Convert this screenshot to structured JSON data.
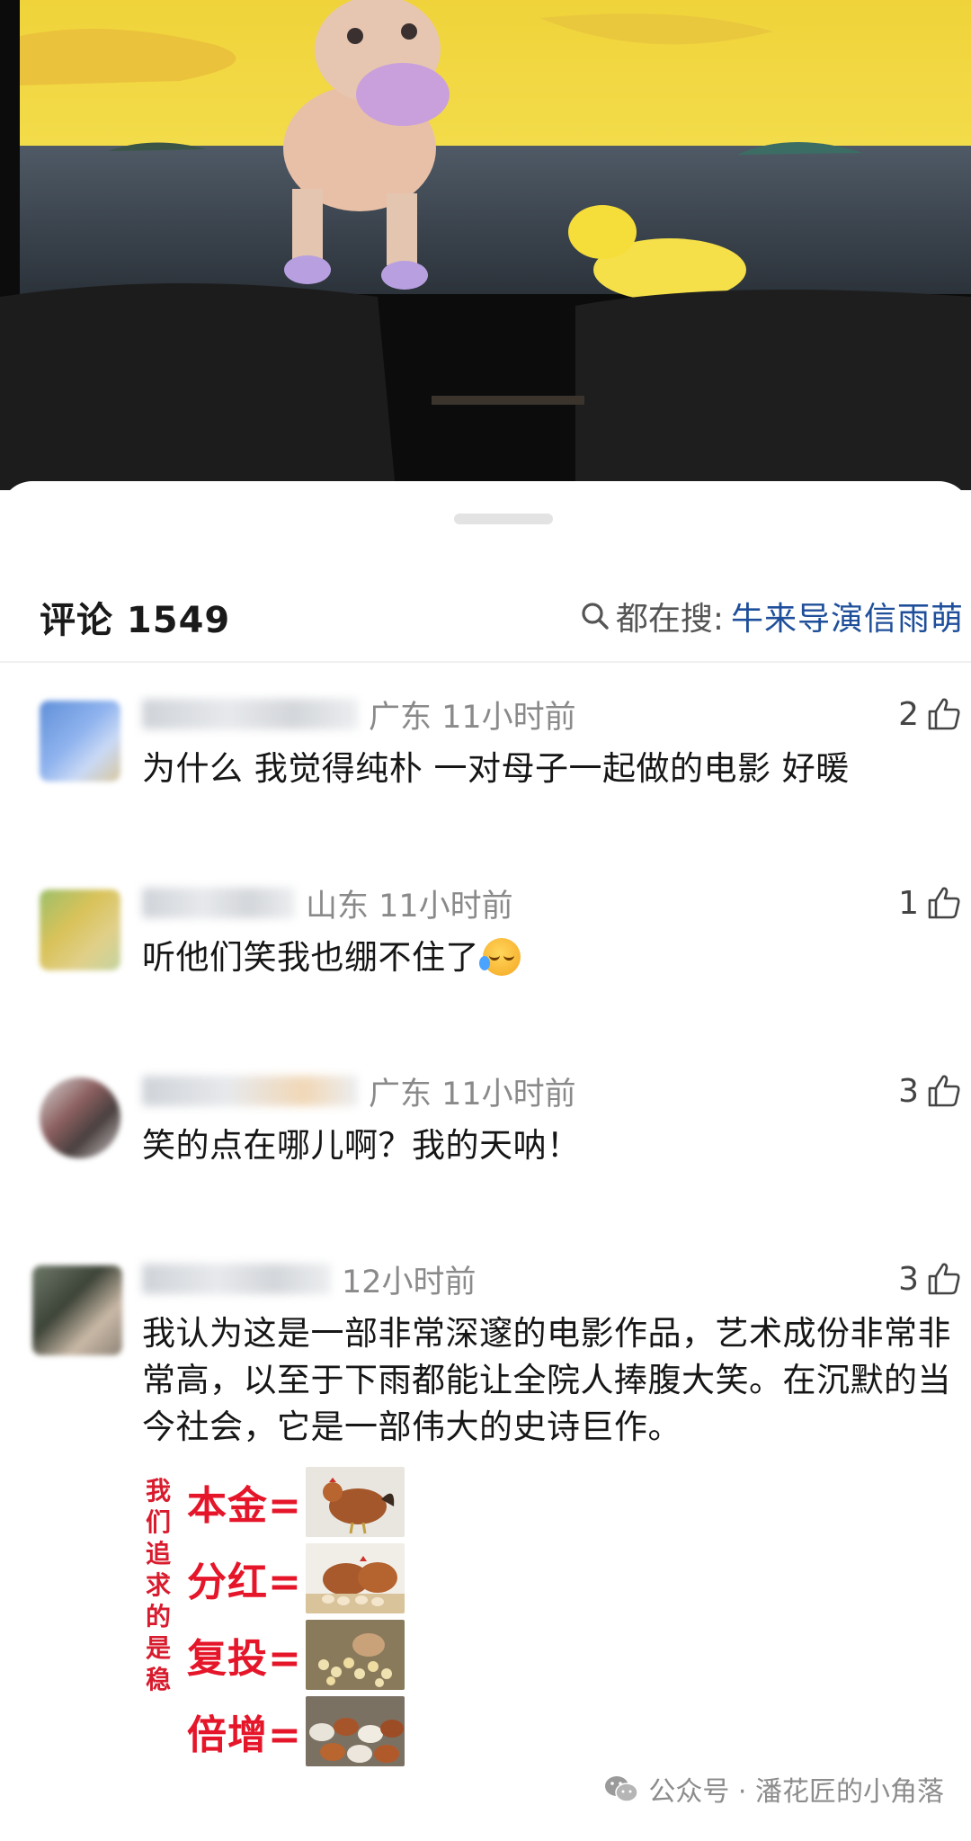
{
  "header": {
    "title": "评论 1549",
    "search_label": "都在搜:",
    "search_term": "牛来导演信雨萌"
  },
  "comments": [
    {
      "meta": "广东 11小时前",
      "text": "为什么 我觉得纯朴 一对母子一起做的电影 好暖",
      "likes": "2"
    },
    {
      "meta": "山东 11小时前",
      "text": "听他们笑我也绷不住了",
      "likes": "1"
    },
    {
      "meta": "广东 11小时前",
      "text": "笑的点在哪儿啊？我的天呐！",
      "likes": "3"
    },
    {
      "meta": "12小时前",
      "text": "我认为这是一部非常深邃的电影作品，艺术成份非常非常高，以至于下雨都能让全院人捧腹大笑。在沉默的当今社会，它是一部伟大的史诗巨作。",
      "likes": "3"
    }
  ],
  "meme": {
    "side_text": "我们追求的是稳",
    "rows": [
      "本金=",
      "分红=",
      "复投=",
      "倍增="
    ]
  },
  "watermark": "公众号 · 潘花匠的小角落",
  "icons": {
    "search": "search-icon",
    "like": "thumbs-up-icon",
    "emoji": "crying-laughing-emoji-icon",
    "wechat": "wechat-icon"
  },
  "colors": {
    "search_term": "#1f4f9a",
    "meme_red": "#e5162a",
    "meta_gray": "#8a8a8a"
  }
}
